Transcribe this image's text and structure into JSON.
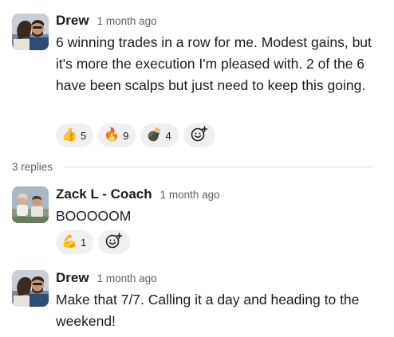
{
  "messages": [
    {
      "author": "Drew",
      "time": "1 month ago",
      "avatar": "avatar-drew",
      "text": "6 winning trades in a row for me. Modest gains, but it's more the execution I'm pleased with. 2 of the 6 have been scalps but just need to keep this going.",
      "reactions": [
        {
          "emoji": "👍",
          "icon": "thumbs-up-icon",
          "count": "5"
        },
        {
          "emoji": "🔥",
          "icon": "fire-icon",
          "count": "9"
        },
        {
          "emoji": "💣",
          "icon": "bomb-icon",
          "count": "4"
        }
      ]
    },
    {
      "author": "Zack L - Coach",
      "time": "1 month ago",
      "avatar": "avatar-zack",
      "text": "BOOOOOM",
      "reactions": [
        {
          "emoji": "💪",
          "icon": "flexed-biceps-icon",
          "count": "1"
        }
      ]
    },
    {
      "author": "Drew",
      "time": "1 month ago",
      "avatar": "avatar-drew",
      "text": "Make that 7/7. Calling it a day and heading to the weekend!",
      "reactions": []
    }
  ],
  "thread": {
    "replies_label": "3 replies"
  },
  "colors": {
    "text": "#1d1c1d",
    "muted": "#616061",
    "reaction_bg": "#f0f0f0",
    "divider": "#dddddd"
  }
}
